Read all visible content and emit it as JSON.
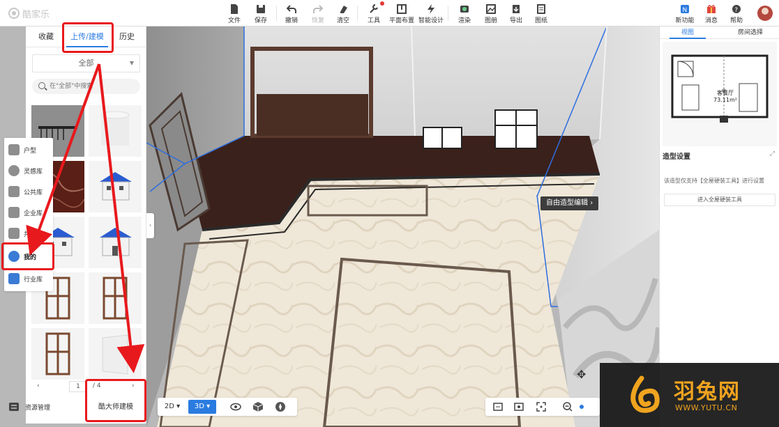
{
  "app": {
    "logo_text": "酷家乐"
  },
  "toolbar": {
    "items": [
      {
        "label": "文件"
      },
      {
        "label": "保存"
      },
      {
        "label": "撤销"
      },
      {
        "label": "恢复"
      },
      {
        "label": "清空"
      },
      {
        "label": "工具"
      },
      {
        "label": "平面布置"
      },
      {
        "label": "智能设计"
      },
      {
        "label": "渲染"
      },
      {
        "label": "图册"
      },
      {
        "label": "导出"
      },
      {
        "label": "图纸"
      }
    ],
    "right_items": [
      {
        "label": "新功能"
      },
      {
        "label": "消息"
      },
      {
        "label": "帮助"
      }
    ]
  },
  "leftnav": {
    "items": [
      {
        "label": "户型"
      },
      {
        "label": "灵感库"
      },
      {
        "label": "公共库"
      },
      {
        "label": "企业库"
      },
      {
        "label": "共享库"
      },
      {
        "label": "我的"
      },
      {
        "label": "行业库"
      }
    ]
  },
  "catalog": {
    "tabs": [
      {
        "label": "收藏"
      },
      {
        "label": "上传/建模"
      },
      {
        "label": "历史"
      }
    ],
    "filter_value": "全部",
    "search_placeholder": "在\"全部\"中搜索",
    "pager": {
      "prev": "‹",
      "page": "1",
      "total": "/ 4",
      "next": "›"
    },
    "master_button": "酷大师建模",
    "resource_manager": "资源管理"
  },
  "viewport": {
    "view_2d": "2D",
    "view_3d": "3D",
    "tooltip": "自由造型编辑",
    "tooltip_arrow": "›"
  },
  "rightpanel": {
    "tabs": [
      {
        "label": "视图"
      },
      {
        "label": "房间选择"
      }
    ],
    "room_name": "客餐厅",
    "room_area": "73.11m²",
    "panel_title": "造型设置",
    "panel_desc": "该造型仅支持【全屋硬装工具】进行设置",
    "panel_button": "进入全屋硬装工具"
  },
  "watermark": {
    "name": "羽兔网",
    "url": "WWW.YUTU.CN"
  },
  "colors": {
    "accent": "#2b7ce0",
    "annotation": "#e8191d",
    "floor_wood": "#3b211b",
    "watermark": "#f0a41f"
  }
}
